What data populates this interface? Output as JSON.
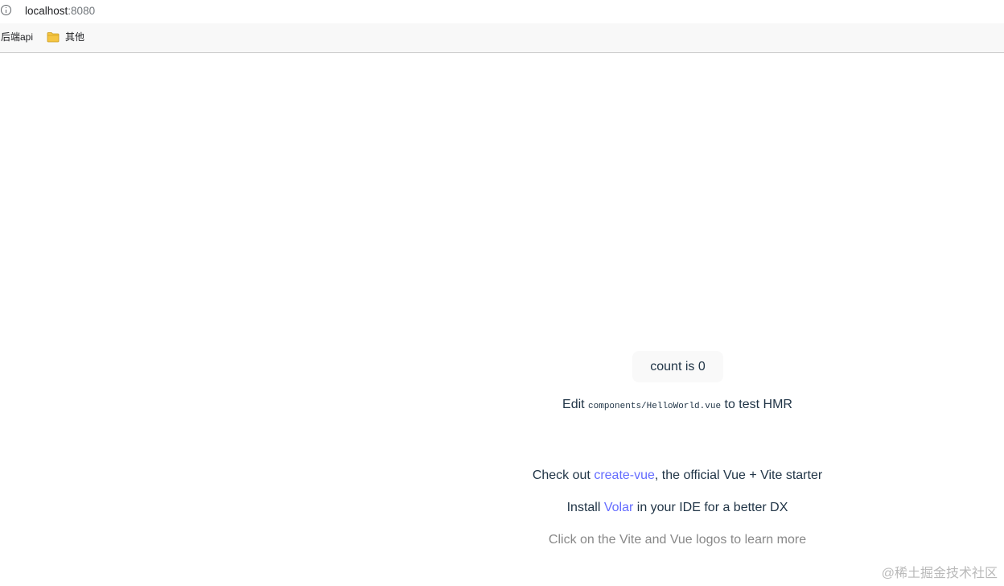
{
  "browser": {
    "url_host": "localhost",
    "url_port": ":8080",
    "bookmarks": [
      {
        "label": "后端api"
      },
      {
        "label": "其他",
        "icon": "folder-icon"
      }
    ]
  },
  "app": {
    "counter_label": "count is 0",
    "edit": {
      "prefix": "Edit ",
      "code": "components/HelloWorld.vue",
      "suffix": " to test HMR"
    },
    "starter": {
      "prefix": "Check out ",
      "link": "create-vue",
      "suffix": ", the official Vue + Vite starter"
    },
    "volar": {
      "prefix": "Install ",
      "link": "Volar",
      "suffix": " in your IDE for a better DX"
    },
    "logo_hint": "Click on the Vite and Vue logos to learn more"
  },
  "watermark": "@稀土掘金技术社区",
  "colors": {
    "link": "#646cff",
    "text": "#213547",
    "muted": "#888888",
    "folder": "#f5c542"
  }
}
